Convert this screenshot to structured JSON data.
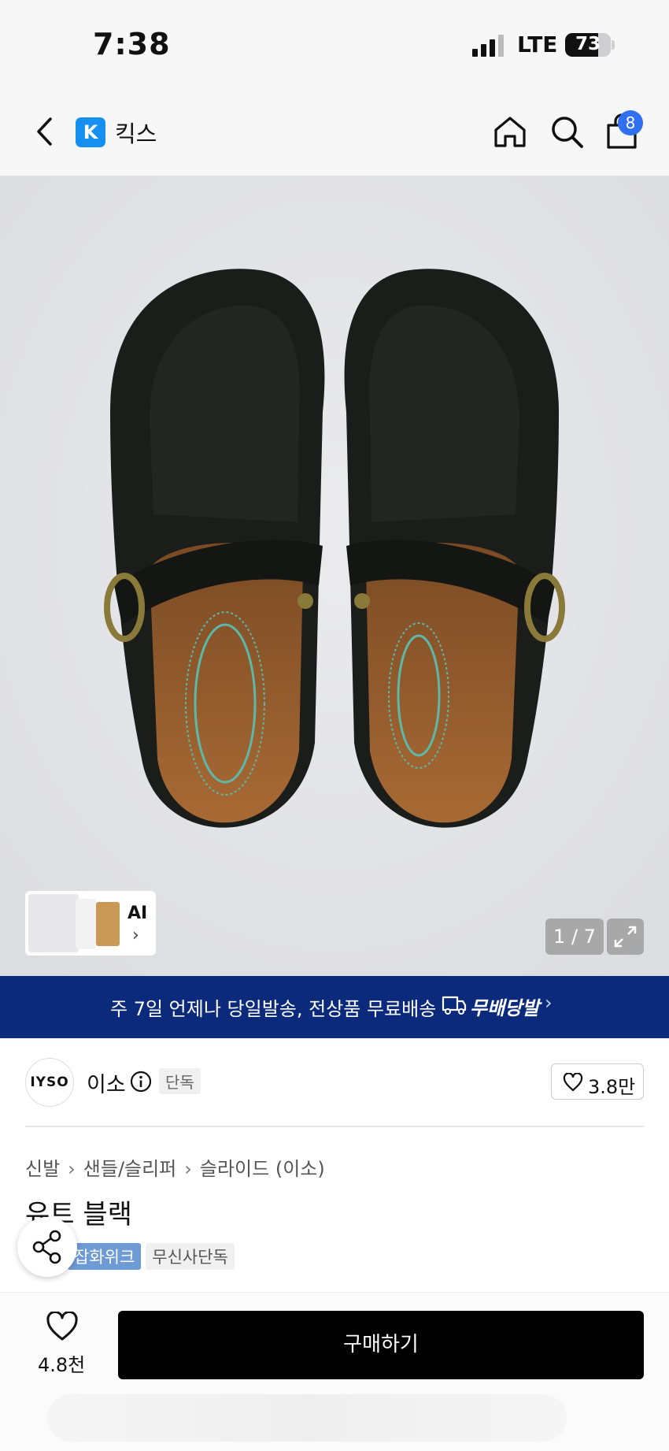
{
  "status_bar": {
    "time": "7:38",
    "network": "LTE",
    "battery": "73",
    "battery_level": 0.73
  },
  "nav": {
    "app_name": "킥스",
    "logo_letter": "K",
    "cart_count": "8"
  },
  "gallery": {
    "ai_label": "AI",
    "page_indicator": "1 / 7"
  },
  "banner": {
    "text": "주 7일 언제나 당일발송, 전상품 무료배송",
    "brand": "무배당발"
  },
  "brand": {
    "logo_text": "IYSO",
    "name": "이소",
    "exclusive": "단독",
    "likes": "3.8만"
  },
  "breadcrumb": [
    "신발",
    "샌들/슬리퍼",
    "슬라이드 (이소)"
  ],
  "product": {
    "title": "유트 블랙",
    "tags": [
      "잡화위크",
      "무신사단독"
    ]
  },
  "bottom": {
    "wish_count": "4.8천",
    "buy_label": "구매하기"
  },
  "colors": {
    "banner_bg": "#0b2a7c",
    "badge": "#2f6ff0",
    "logo": "#1690f0",
    "buy_bg": "#000000"
  }
}
